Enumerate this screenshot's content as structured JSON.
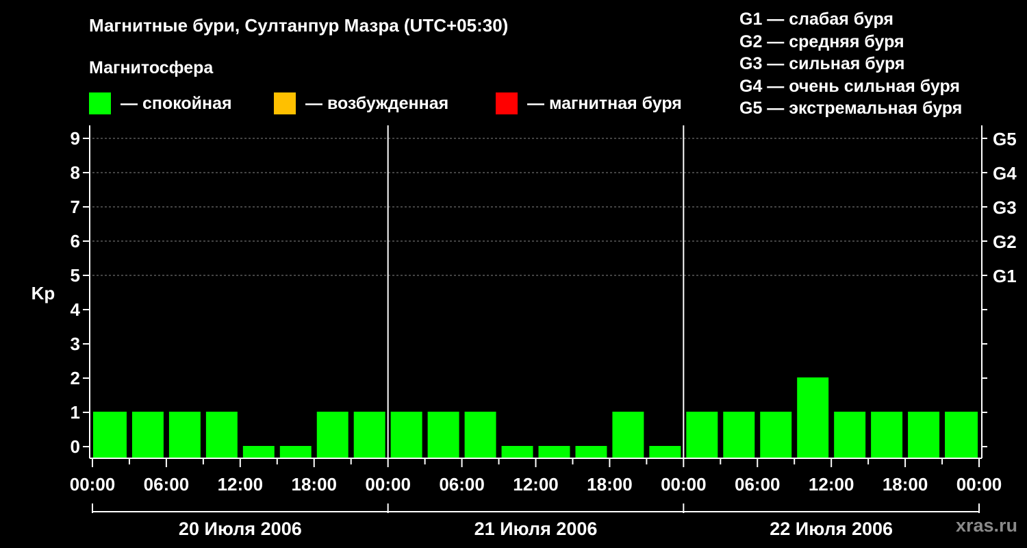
{
  "header": {
    "title": "Магнитные бури, Султанпур Мазра (UTC+05:30)",
    "magnetosphere_label": "Магнитосфера"
  },
  "legend": [
    {
      "label": "— спокойная",
      "color": "#00ff00"
    },
    {
      "label": "— возбужденная",
      "color": "#ffc000"
    },
    {
      "label": "— магнитная буря",
      "color": "#ff0000"
    }
  ],
  "g_scale": [
    "G1 — слабая буря",
    "G2 — средняя буря",
    "G3 — сильная буря",
    "G4 — очень сильная буря",
    "G5 — экстремальная буря"
  ],
  "watermark": "xras.ru",
  "chart_data": {
    "type": "bar",
    "ylabel": "Kp",
    "ylim": [
      0,
      9
    ],
    "y_ticks": [
      "0",
      "1",
      "2",
      "3",
      "4",
      "5",
      "6",
      "7",
      "8",
      "9"
    ],
    "right_axis_labels": [
      {
        "kp": 5,
        "label": "G1"
      },
      {
        "kp": 6,
        "label": "G2"
      },
      {
        "kp": 7,
        "label": "G3"
      },
      {
        "kp": 8,
        "label": "G4"
      },
      {
        "kp": 9,
        "label": "G5"
      }
    ],
    "x_tick_labels": [
      "00:00",
      "06:00",
      "12:00",
      "18:00",
      "00:00",
      "06:00",
      "12:00",
      "18:00",
      "00:00",
      "06:00",
      "12:00",
      "18:00",
      "00:00"
    ],
    "days": [
      "20 Июля 2006",
      "21 Июля 2006",
      "22 Июля 2006"
    ],
    "interval_hours": 3,
    "kp_values": [
      1,
      1,
      1,
      1,
      0,
      0,
      1,
      1,
      1,
      1,
      1,
      0,
      0,
      0,
      1,
      0,
      1,
      1,
      1,
      2,
      1,
      1,
      1,
      1
    ],
    "color_thresholds": {
      "quiet": "#00ff00",
      "active": "#ffc000",
      "storm": "#ff0000"
    },
    "grid": "dashed at kp 5-9"
  }
}
